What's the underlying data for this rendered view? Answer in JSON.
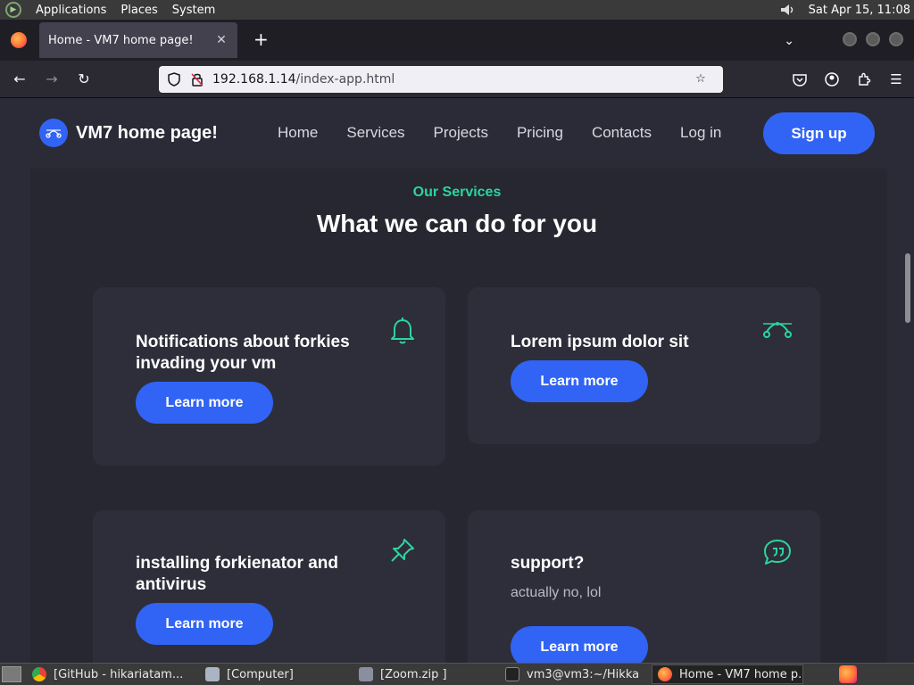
{
  "system_panel": {
    "menus": [
      "Applications",
      "Places",
      "System"
    ],
    "clock": "Sat Apr 15, 11:08"
  },
  "browser": {
    "tab_title": "Home - VM7 home page!",
    "new_tab": "+",
    "url_host": "192.168.1.14",
    "url_path": "/index-app.html"
  },
  "site": {
    "brand": "VM7 home page!",
    "nav": [
      "Home",
      "Services",
      "Projects",
      "Pricing",
      "Contacts",
      "Log in"
    ],
    "signup": "Sign up"
  },
  "services": {
    "eyebrow": "Our Services",
    "title": "What we can do for you",
    "cards": [
      {
        "title": "Notifications about forkies invading your vm",
        "desc": "",
        "button": "Learn more",
        "icon": "bell-icon"
      },
      {
        "title": "Lorem ipsum dolor sit",
        "desc": "",
        "button": "Learn more",
        "icon": "bezier-curve-icon"
      },
      {
        "title": "installing forkienator and antivirus",
        "desc": "",
        "button": "Learn more",
        "icon": "pin-icon"
      },
      {
        "title": "support?",
        "desc": "actually no, lol",
        "button": "Learn more",
        "icon": "quote-bubble-icon"
      }
    ]
  },
  "taskbar": {
    "items": [
      "[GitHub - hikariatam...",
      "[Computer]",
      "[Zoom.zip ]",
      "vm3@vm3:~/Hikka",
      "Home - VM7 home p..."
    ]
  },
  "colors": {
    "accent": "#3164f4",
    "teal": "#2dd4a0",
    "page_bg": "#2a2b36",
    "card_bg": "#2d2e39"
  }
}
